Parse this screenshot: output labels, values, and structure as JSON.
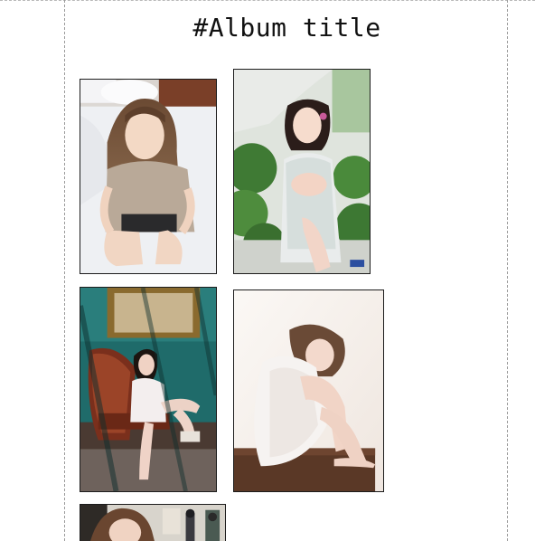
{
  "album": {
    "title": "#Album title"
  },
  "photos": [
    {
      "description": "girl-bedroom-photo"
    },
    {
      "description": "girl-garden-photo"
    },
    {
      "description": "girl-chair-photo"
    },
    {
      "description": "girl-white-dress-photo"
    },
    {
      "description": "girl-street-photo"
    }
  ]
}
